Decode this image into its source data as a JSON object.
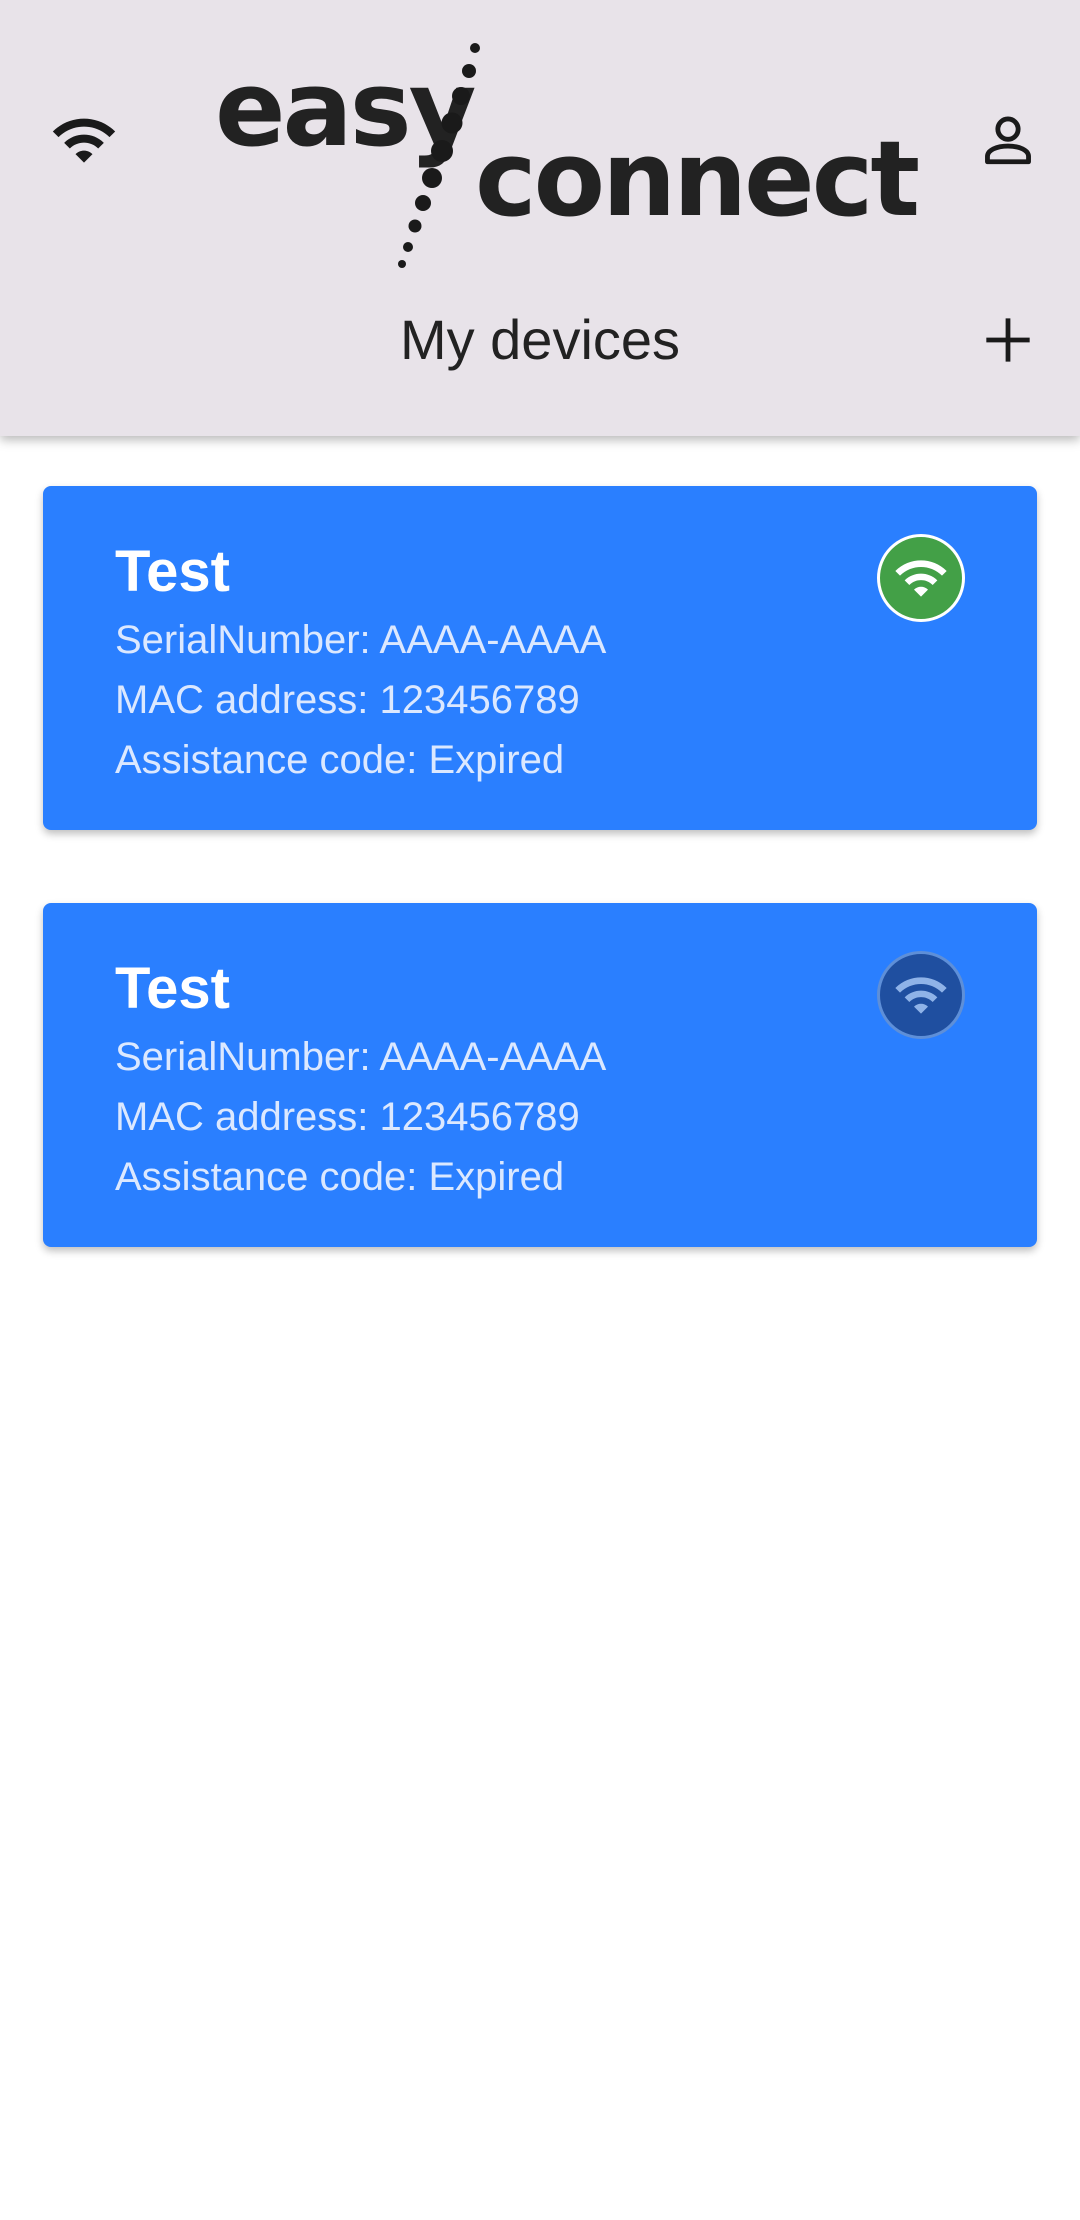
{
  "header": {
    "logo": {
      "word1": "easy",
      "word2": "connect"
    },
    "title": "My devices",
    "icons": {
      "left": "wifi-icon",
      "right": "person-icon",
      "add": "plus-icon"
    }
  },
  "devices": [
    {
      "name": "Test",
      "serial": "SerialNumber: AAAA-AAAA",
      "mac": "MAC address: 123456789",
      "assistance": "Assistance code: Expired",
      "status": "online",
      "status_color": "#43a047"
    },
    {
      "name": "Test",
      "serial": "SerialNumber: AAAA-AAAA",
      "mac": "MAC address: 123456789",
      "assistance": "Assistance code: Expired",
      "status": "offline",
      "status_color": "#1f4fa0"
    }
  ],
  "colors": {
    "header_bg": "#e8e3e9",
    "card_bg": "#2a7fff",
    "text_dark": "#222222"
  }
}
